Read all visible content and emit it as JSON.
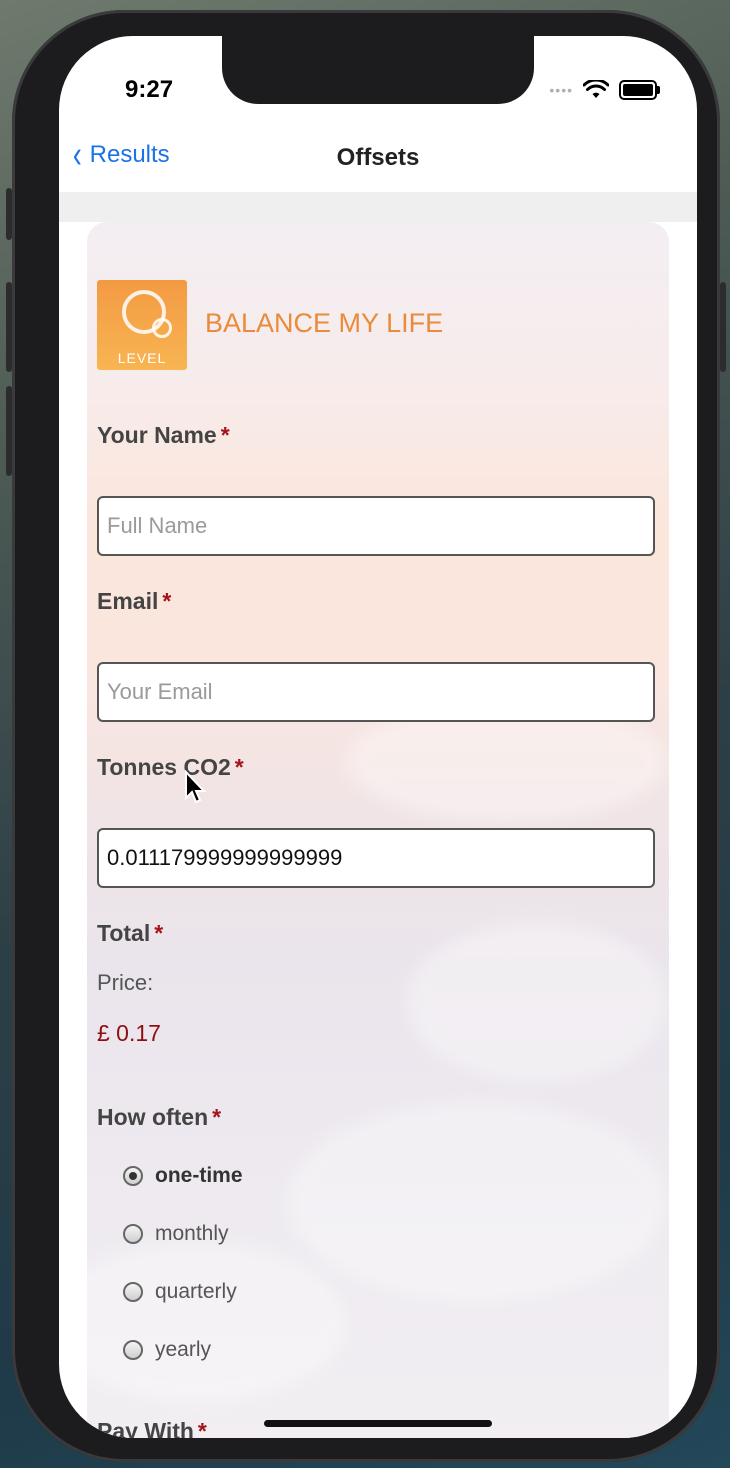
{
  "status_bar": {
    "time": "9:27"
  },
  "navbar": {
    "back_label": "Results",
    "title": "Offsets"
  },
  "brand": {
    "logo_text": "LEVEL",
    "name": "BALANCE MY LIFE"
  },
  "form": {
    "name": {
      "label": "Your Name",
      "required_mark": "*",
      "placeholder": "Full Name",
      "value": ""
    },
    "email": {
      "label": "Email",
      "required_mark": "*",
      "placeholder": "Your Email",
      "value": ""
    },
    "tonnes": {
      "label": "Tonnes CO2",
      "required_mark": "*",
      "value": "0.011179999999999999"
    },
    "total": {
      "label": "Total",
      "required_mark": "*",
      "price_label": "Price:",
      "price_value": "£ 0.17"
    },
    "frequency": {
      "label": "How often",
      "required_mark": "*",
      "options": [
        "one-time",
        "monthly",
        "quarterly",
        "yearly"
      ],
      "selected": "one-time"
    },
    "pay_with": {
      "label": "Pay With",
      "required_mark": "*"
    }
  },
  "colors": {
    "accent": "#1a73e8",
    "brand": "#e98b3c",
    "required": "#a5141b",
    "price": "#8e0f12"
  }
}
